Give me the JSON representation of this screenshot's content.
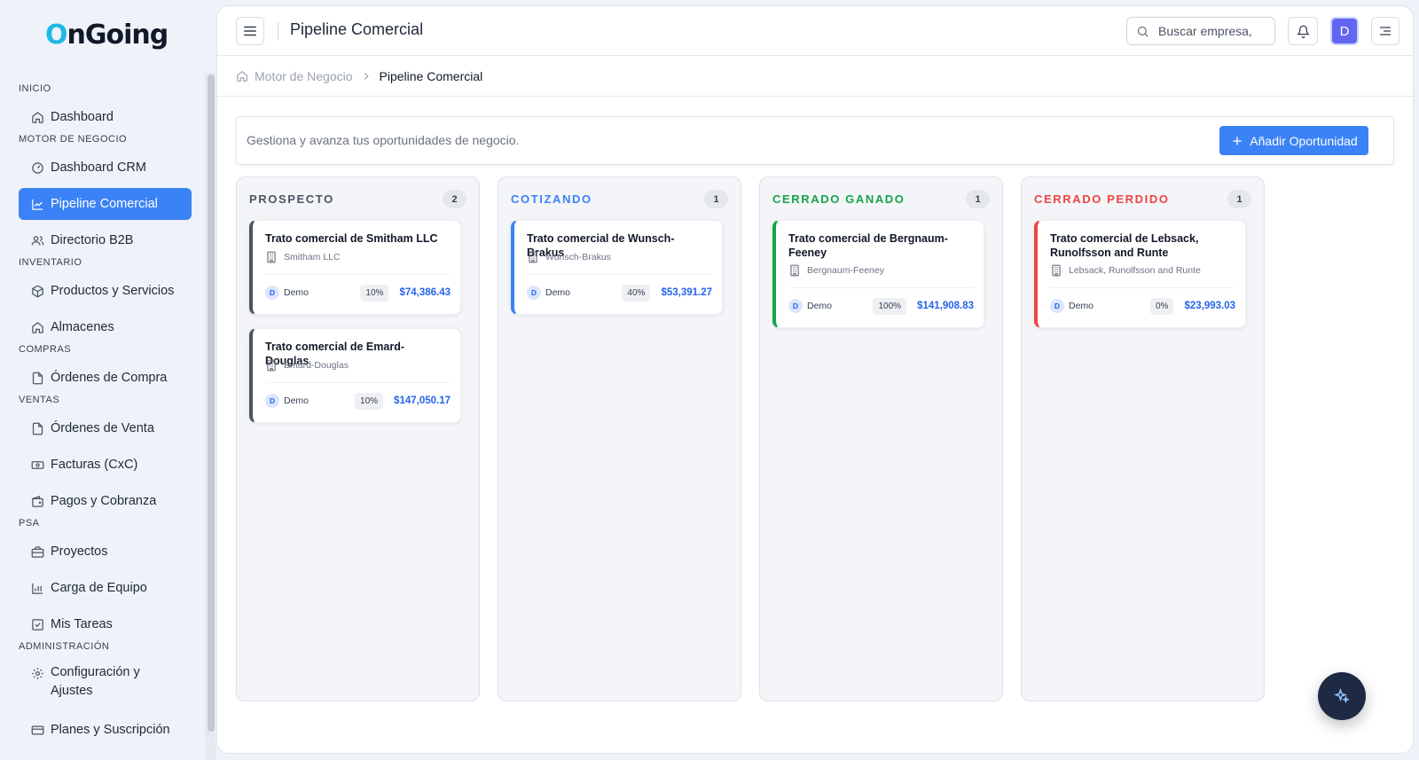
{
  "brand": {
    "logo_first": "O",
    "logo_rest": "nGoing"
  },
  "sidebar": {
    "sections": [
      {
        "label": "INICIO"
      },
      {
        "label": "MOTOR DE NEGOCIO"
      },
      {
        "label": "INVENTARIO"
      },
      {
        "label": "COMPRAS"
      },
      {
        "label": "VENTAS"
      },
      {
        "label": "PSA"
      },
      {
        "label": "ADMINISTRACIÓN"
      }
    ],
    "items": [
      {
        "label": "Dashboard",
        "icon": "home-icon"
      },
      {
        "label": "Dashboard CRM",
        "icon": "gauge-icon"
      },
      {
        "label": "Pipeline Comercial",
        "icon": "chart-line-icon",
        "active": true
      },
      {
        "label": "Directorio B2B",
        "icon": "users-icon"
      },
      {
        "label": "Productos y Servicios",
        "icon": "box-icon"
      },
      {
        "label": "Almacenes",
        "icon": "warehouse-icon"
      },
      {
        "label": "Órdenes de Compra",
        "icon": "document-icon"
      },
      {
        "label": "Órdenes de Venta",
        "icon": "document-icon"
      },
      {
        "label": "Facturas (CxC)",
        "icon": "banknote-icon"
      },
      {
        "label": "Pagos y Cobranza",
        "icon": "wallet-icon"
      },
      {
        "label": "Proyectos",
        "icon": "briefcase-icon"
      },
      {
        "label": "Carga de Equipo",
        "icon": "bar-chart-icon"
      },
      {
        "label": "Mis Tareas",
        "icon": "checkbox-icon"
      },
      {
        "label": "Configuración y Ajustes",
        "icon": "gear-icon"
      },
      {
        "label": "Planes y Suscripción",
        "icon": "credit-card-icon"
      }
    ]
  },
  "header": {
    "title": "Pipeline Comercial",
    "search_placeholder": "Buscar empresa,",
    "avatar_initial": "D"
  },
  "breadcrumb": {
    "parent": "Motor de Negocio",
    "current": "Pipeline Comercial"
  },
  "page": {
    "description": "Gestiona y avanza tus oportunidades de negocio.",
    "add_button": "Añadir Oportunidad"
  },
  "pipeline": {
    "columns": [
      {
        "title": "PROSPECTO",
        "count": "2",
        "color": "#4b5563",
        "cards": [
          {
            "title": "Trato comercial de Smitham LLC",
            "company": "Smitham LLC",
            "owner_initial": "D",
            "owner": "Demo",
            "probability": "10%",
            "amount": "$74,386.43"
          },
          {
            "title": "Trato comercial de Emard-Douglas",
            "company": "Emard-Douglas",
            "owner_initial": "D",
            "owner": "Demo",
            "probability": "10%",
            "amount": "$147,050.17"
          }
        ]
      },
      {
        "title": "COTIZANDO",
        "count": "1",
        "color": "#3b82f6",
        "cards": [
          {
            "title": "Trato comercial de Wunsch-Brakus",
            "company": "Wunsch-Brakus",
            "owner_initial": "D",
            "owner": "Demo",
            "probability": "40%",
            "amount": "$53,391.27"
          }
        ]
      },
      {
        "title": "CERRADO GANADO",
        "count": "1",
        "color": "#16a34a",
        "cards": [
          {
            "title": "Trato comercial de Bergnaum-Feeney",
            "company": "Bergnaum-Feeney",
            "owner_initial": "D",
            "owner": "Demo",
            "probability": "100%",
            "amount": "$141,908.83"
          }
        ]
      },
      {
        "title": "CERRADO PERDIDO",
        "count": "1",
        "color": "#ef4444",
        "cards": [
          {
            "title": "Trato comercial de Lebsack, Runolfsson and Runte",
            "company": "Lebsack, Runolfsson and Runte",
            "owner_initial": "D",
            "owner": "Demo",
            "probability": "0%",
            "amount": "$23,993.03"
          }
        ]
      }
    ]
  }
}
